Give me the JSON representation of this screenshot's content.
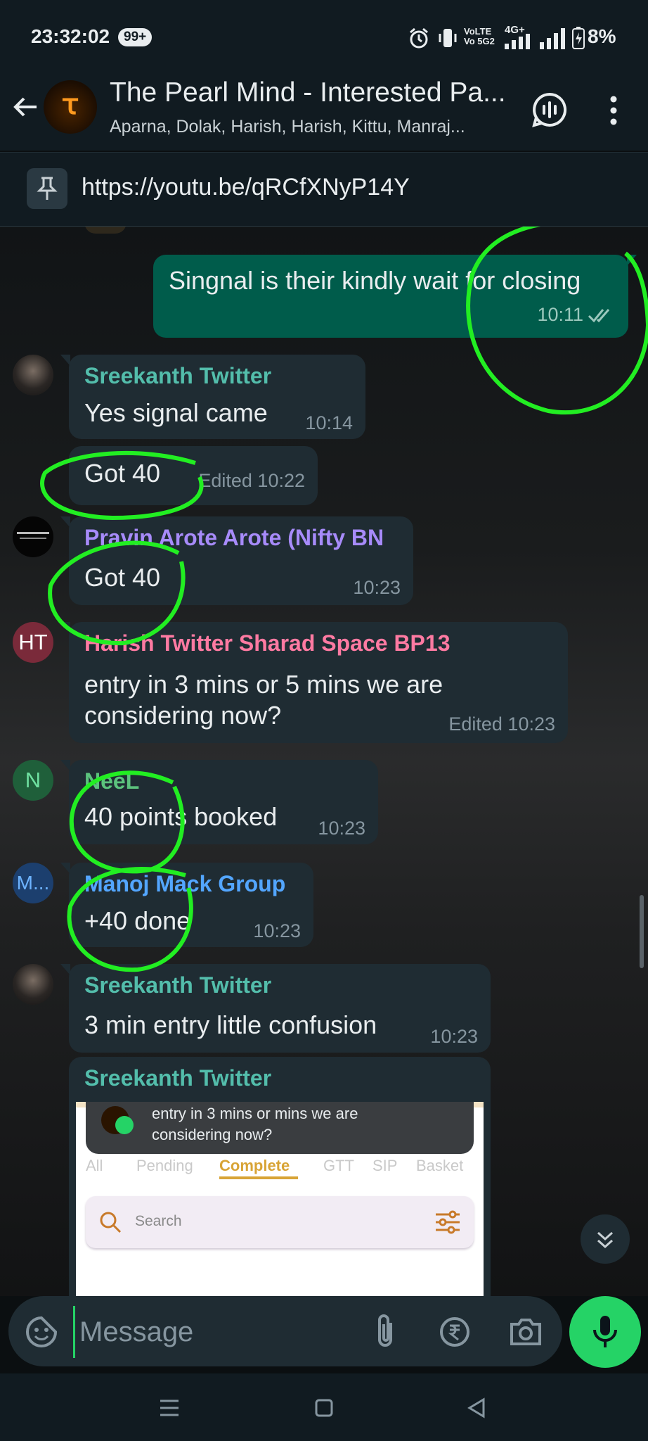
{
  "status_bar": {
    "time": "23:32:02",
    "notification_badge": "99+",
    "network_label": "VoLTE Vo 5G2",
    "network_type": "4G+",
    "battery": "8%"
  },
  "header": {
    "title": "The Pearl Mind - Interested Pa...",
    "members": "Aparna, Dolak, Harish, Harish, Kittu, Manraj...",
    "avatar_glyph": "ꚍ"
  },
  "pinned": {
    "text": "https://youtu.be/qRCfXNyP14Y"
  },
  "messages": {
    "m1": {
      "text": "Singnal is their kindly wait for closing",
      "time": "10:11"
    },
    "m2": {
      "sender": "Sreekanth Twitter",
      "text": "Yes signal came",
      "time": "10:14"
    },
    "m3": {
      "text": "Got 40",
      "time": "Edited 10:22"
    },
    "m4": {
      "sender": "Pravin Arote Arote (Nifty BN",
      "text": "Got 40",
      "time": "10:23"
    },
    "m5": {
      "sender": "Harish Twitter Sharad Space BP13",
      "avatar": "HT",
      "line1": "entry in 3 mins or  5 mins we are",
      "line2": "considering now?",
      "time": "Edited 10:23"
    },
    "m6": {
      "sender": "NeeL",
      "avatar": "N",
      "text": "40 points booked",
      "time": "10:23"
    },
    "m7": {
      "sender": "Manoj Mack Group",
      "avatar": "M...",
      "text": "+40 done",
      "time": "10:23"
    },
    "m8": {
      "sender": "Sreekanth Twitter",
      "text": "3 min entry little confusion",
      "time": "10:23"
    },
    "m9": {
      "sender": "Sreekanth Twitter",
      "toast_line1": "entry in 3 mins or  mins we are",
      "toast_line2": "considering now?",
      "tabs": [
        "All",
        "Pending",
        "Complete",
        "GTT",
        "SIP",
        "Basket"
      ],
      "search_placeholder": "Search"
    }
  },
  "input": {
    "placeholder": "Message"
  },
  "colors": {
    "accent": "#25d366",
    "incoming_bubble": "#1f2c33",
    "outgoing_bubble": "#005c4b",
    "annotation": "#22ee22",
    "name_teal": "#53bdab",
    "name_purple": "#a78bfa",
    "name_pink": "#ff7aa2",
    "name_green": "#5cc27d",
    "name_blue": "#53a6ff"
  }
}
